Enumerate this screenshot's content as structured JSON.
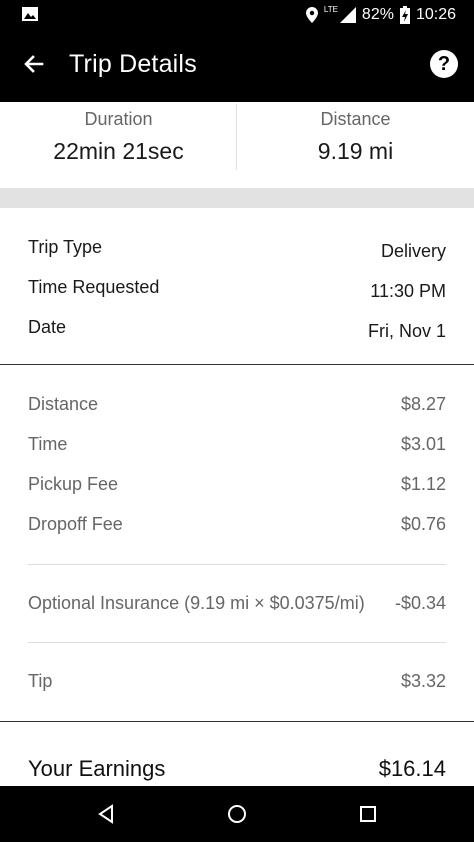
{
  "status_bar": {
    "network": "LTE",
    "battery": "82%",
    "time": "10:26"
  },
  "header": {
    "title": "Trip Details"
  },
  "summary": {
    "duration_label": "Duration",
    "duration_value": "22min 21sec",
    "distance_label": "Distance",
    "distance_value": "9.19 mi"
  },
  "trip_info": [
    {
      "label": "Trip Type",
      "value": "Delivery"
    },
    {
      "label": "Time Requested",
      "value": "11:30 PM"
    },
    {
      "label": "Date",
      "value": "Fri, Nov 1"
    }
  ],
  "fare": {
    "items": [
      {
        "label": "Distance",
        "value": "$8.27"
      },
      {
        "label": "Time",
        "value": "$3.01"
      },
      {
        "label": "Pickup Fee",
        "value": "$1.12"
      },
      {
        "label": "Dropoff Fee",
        "value": "$0.76"
      }
    ],
    "insurance": {
      "label": "Optional Insurance (9.19 mi × $0.0375/mi)",
      "value": "-$0.34"
    },
    "tip": {
      "label": "Tip",
      "value": "$3.32"
    }
  },
  "earnings": {
    "label": "Your Earnings",
    "value": "$16.14"
  },
  "icons": {
    "status_left": "image-icon",
    "location": "location-pin-icon",
    "signal": "signal-icon",
    "battery": "battery-charging-icon",
    "back": "back-arrow-icon",
    "help": "help-icon",
    "nav_back": "nav-back-icon",
    "nav_home": "nav-home-icon",
    "nav_recents": "nav-recents-icon"
  }
}
